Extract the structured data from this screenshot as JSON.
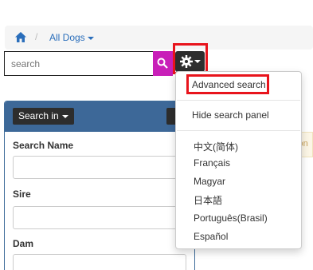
{
  "breadcrumb": {
    "home_icon": "home-icon",
    "separator": "/",
    "current": "All Dogs"
  },
  "search": {
    "placeholder": "search",
    "button_icon": "search-icon",
    "settings_icon": "gear-icon",
    "accent_color": "#c81fb8"
  },
  "panel": {
    "search_in_label": "Search in",
    "fields": [
      {
        "label": "Search Name",
        "value": ""
      },
      {
        "label": "Sire",
        "value": ""
      },
      {
        "label": "Dam",
        "value": ""
      }
    ]
  },
  "notice": {
    "text": "son"
  },
  "menu": {
    "advanced_search": "Advanced search",
    "hide_panel": "Hide search panel",
    "languages": [
      "中文(简体)",
      "Français",
      "Magyar",
      "日本語",
      "Português(Brasil)",
      "Español"
    ]
  },
  "highlight_color": "#e8141c"
}
